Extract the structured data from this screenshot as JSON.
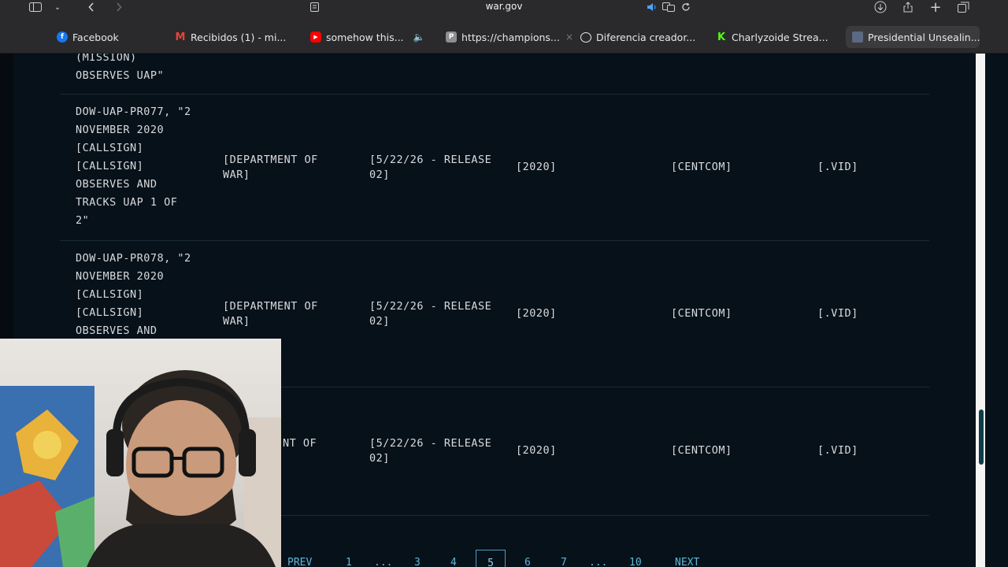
{
  "browser": {
    "url": "war.gov",
    "tabs": [
      {
        "label": "Facebook",
        "icon": "facebook-icon",
        "color": "#1877f2"
      },
      {
        "label": "Recibidos (1) - mi...",
        "icon": "gmail-icon",
        "color": "#ea4335"
      },
      {
        "label": "somehow this...",
        "icon": "youtube-icon",
        "color": "#ff0000"
      },
      {
        "label": "https://champions...",
        "icon": "page-icon",
        "color": "#8e8e93"
      },
      {
        "label": "Diferencia creador...",
        "icon": "openai-icon",
        "color": "#e8e8e8"
      },
      {
        "label": "Charlyzoide Strea...",
        "icon": "kick-icon",
        "color": "#53fc18"
      },
      {
        "label": "Presidential Unsealin...",
        "icon": "gov-icon",
        "color": "#9aa7b8"
      }
    ]
  },
  "table": {
    "partial_row": {
      "title": "(MISSION)\nOBSERVES UAP\""
    },
    "rows": [
      {
        "title": "DOW-UAP-PR077, \"2\nNOVEMBER 2020\n[CALLSIGN]\n[CALLSIGN]\nOBSERVES AND\nTRACKS UAP 1 OF\n2\"",
        "agency": "[DEPARTMENT OF WAR]",
        "release": "[5/22/26 - RELEASE 02]",
        "year": "[2020]",
        "command": "[CENTCOM]",
        "type": "[.VID]"
      },
      {
        "title": "DOW-UAP-PR078, \"2\nNOVEMBER 2020\n[CALLSIGN]\n[CALLSIGN]\nOBSERVES AND",
        "agency": "[DEPARTMENT OF WAR]",
        "release": "[5/22/26 - RELEASE 02]",
        "year": "[2020]",
        "command": "[CENTCOM]",
        "type": "[.VID]"
      },
      {
        "title": "",
        "agency": "NT OF",
        "release": "[5/22/26 - RELEASE 02]",
        "year": "[2020]",
        "command": "[CENTCOM]",
        "type": "[.VID]"
      }
    ]
  },
  "pagination": {
    "prev": "PREV",
    "pages": [
      "1",
      "...",
      "3",
      "4",
      "5",
      "6",
      "7",
      "...",
      "10"
    ],
    "current": "5",
    "next": "NEXT"
  }
}
